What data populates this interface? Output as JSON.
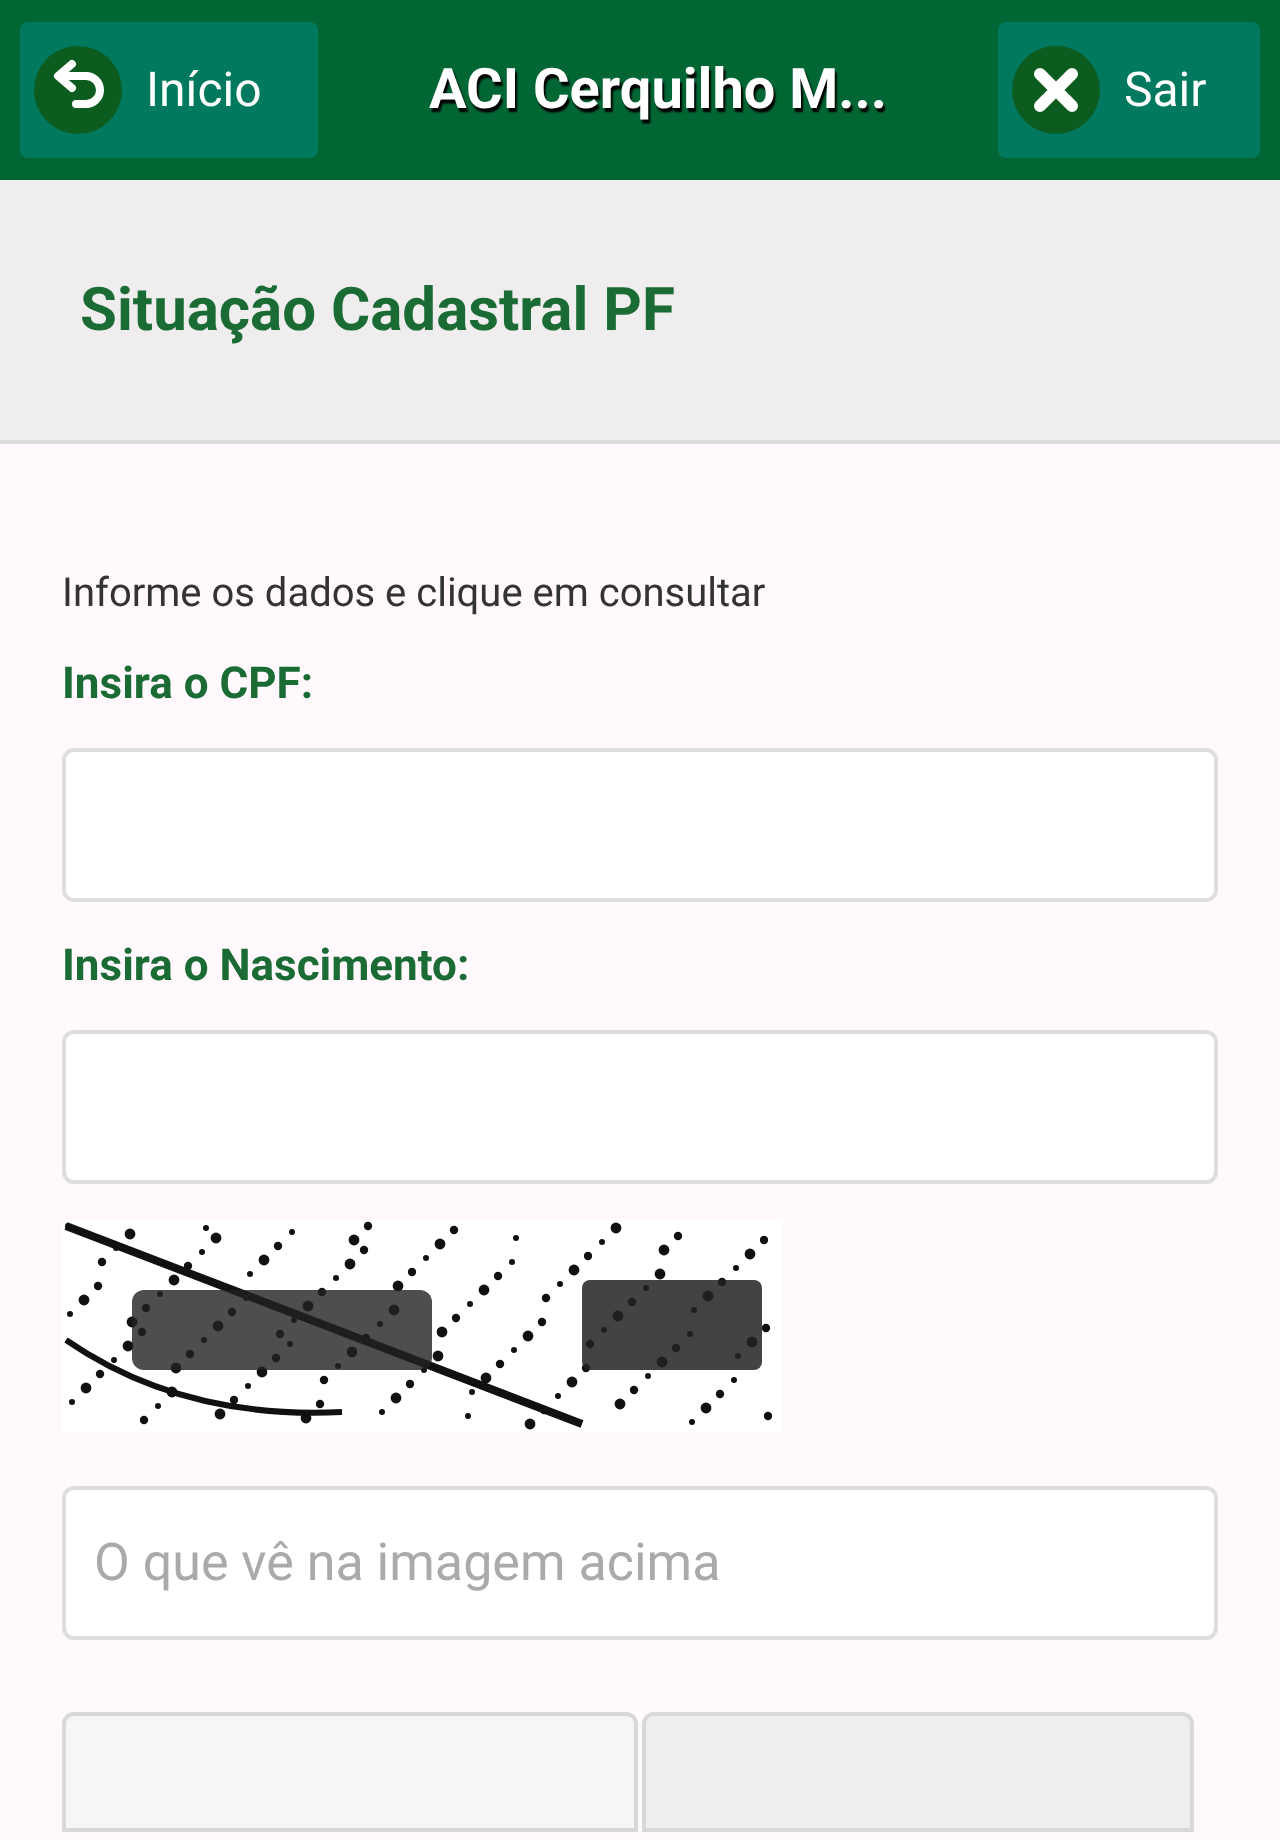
{
  "header": {
    "back_button": "Início",
    "title": "ACI Cerquilho M...",
    "exit_button": "Sair"
  },
  "page_title": "Situação Cadastral PF",
  "intro": "Informe os dados e clique em consultar",
  "fields": [
    {
      "label": "Insira o CPF:"
    },
    {
      "label": "Insira o Nascimento:"
    }
  ],
  "captcha_field": {
    "placeholder": "O que vê na imagem acima"
  }
}
